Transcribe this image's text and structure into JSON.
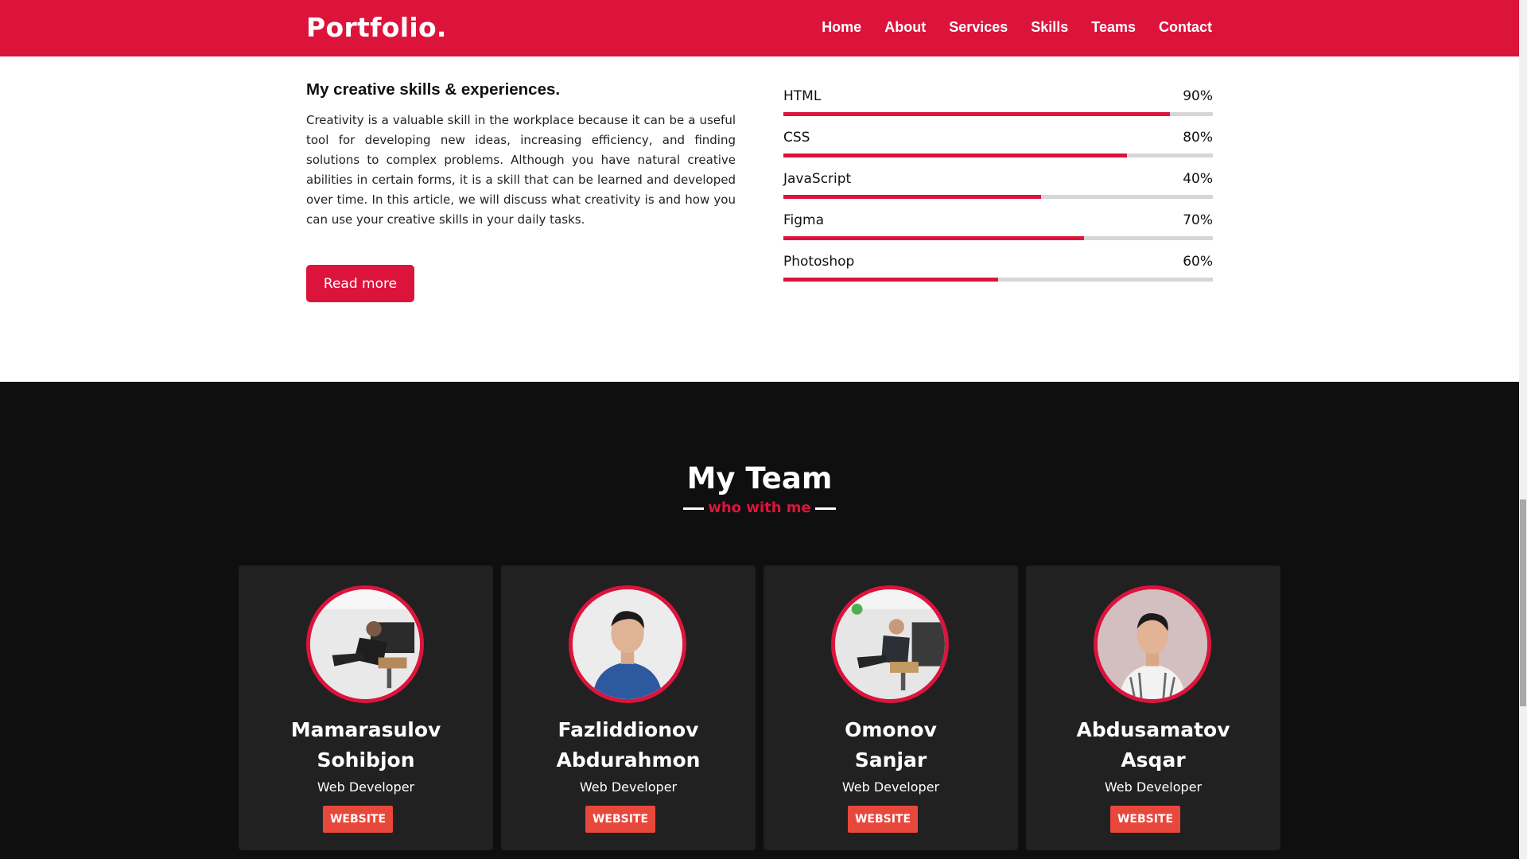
{
  "brand": {
    "logo": "Portfolio."
  },
  "nav": [
    {
      "label": "Home"
    },
    {
      "label": "About"
    },
    {
      "label": "Services"
    },
    {
      "label": "Skills"
    },
    {
      "label": "Teams"
    },
    {
      "label": "Contact"
    }
  ],
  "skills": {
    "heading": "My creative skills & experiences.",
    "text": "Creativity is a valuable skill in the workplace because it can be a useful tool for developing new ideas, increasing efficiency, and finding solutions to complex problems. Although you have natural creative abilities in certain forms, it is a skill that can be learned and developed over time. In this article, we will discuss what creativity is and how you can use your creative skills in your daily tasks.",
    "button": "Read more",
    "bars": [
      {
        "label": "HTML",
        "percent": "90%",
        "value": 90
      },
      {
        "label": "CSS",
        "percent": "80%",
        "value": 80
      },
      {
        "label": "JavaScript",
        "percent": "40%",
        "value": 60
      },
      {
        "label": "Figma",
        "percent": "70%",
        "value": 70
      },
      {
        "label": "Photoshop",
        "percent": "60%",
        "value": 50
      }
    ]
  },
  "team": {
    "title": "My Team",
    "subtitle": "who with me",
    "members": [
      {
        "name_line1": "Mamarasulov",
        "name_line2": "Sohibjon",
        "role": "Web Developer",
        "button": "WEBSITE"
      },
      {
        "name_line1": "Fazliddionov",
        "name_line2": "Abdurahmon",
        "role": "Web Developer",
        "button": "WEBSITE"
      },
      {
        "name_line1": "Omonov",
        "name_line2": "Sanjar",
        "role": "Web Developer",
        "button": "WEBSITE"
      },
      {
        "name_line1": "Abdusamatov",
        "name_line2": "Asqar",
        "role": "Web Developer",
        "button": "WEBSITE"
      }
    ]
  },
  "colors": {
    "accent": "#dc143c",
    "dark": "#0f0f10",
    "card": "#212121",
    "button_secondary": "#e8483c"
  }
}
